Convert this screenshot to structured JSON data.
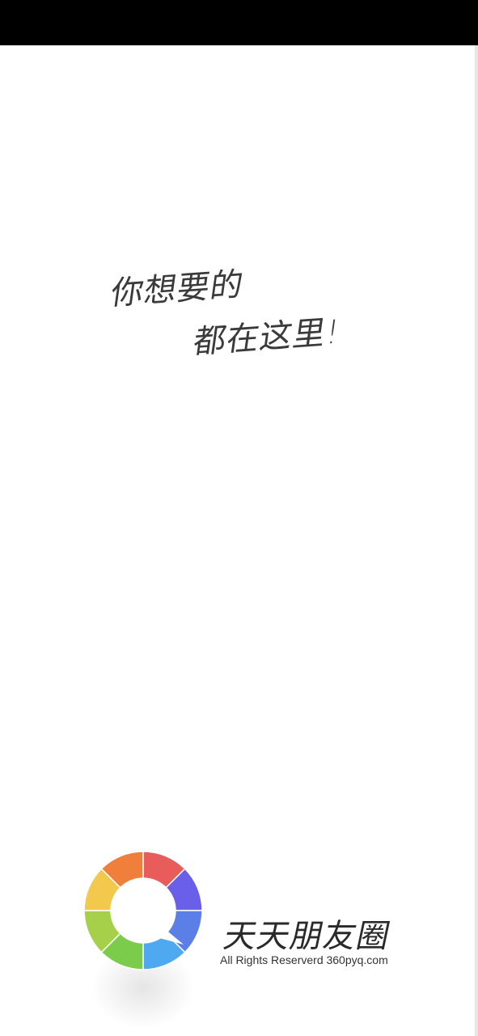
{
  "slogan": {
    "line1": "你想要的",
    "line2": "都在这里!"
  },
  "brand": {
    "name": "天天朋友圈",
    "copyright": "All Rights Reserverd 360pyq.com",
    "logo_icon": "color-ring-chat-bubble-icon",
    "logo_colors": [
      "#e85c5c",
      "#6a5fe8",
      "#5b7fe6",
      "#4fa9f0",
      "#7acc4a",
      "#a6d04a",
      "#f2c94c",
      "#ef7f3a"
    ]
  },
  "theme": {
    "background": "#ffffff",
    "status_bar": "#000000",
    "text": "#3a3a3a"
  }
}
